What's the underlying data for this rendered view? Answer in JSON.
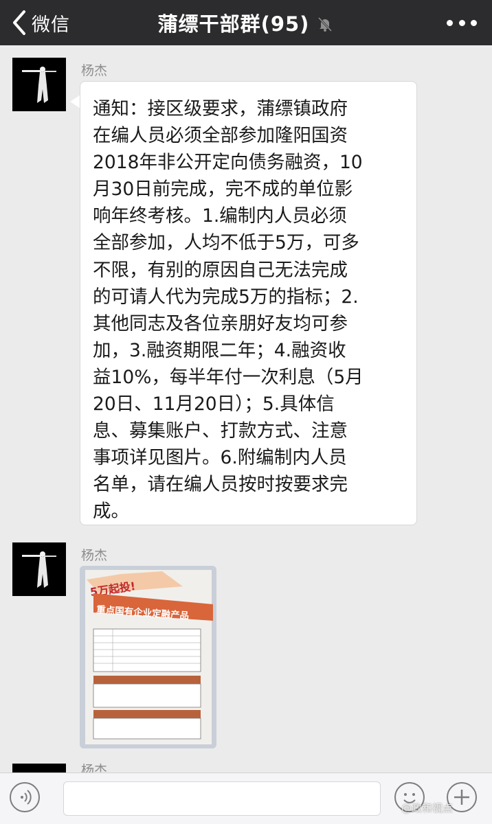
{
  "navbar": {
    "back_label": "微信",
    "title": "蒲缥干部群(95)",
    "mute_icon": "bell-slash-icon",
    "more_icon": "ellipsis-icon",
    "bg_color": "#2c2c2e"
  },
  "messages": [
    {
      "sender": "杨杰",
      "text": "通知：接区级要求，蒲缥镇政府\n在编人员必须全部参加隆阳国资\n2018年非公开定向债务融资，10\n月30日前完成，完不成的单位影\n响年终考核。1.编制内人员必须\n全部参加，人均不低于5万，可多\n不限，有别的原因自己无法完成\n的可请人代为完成5万的指标；2.\n其他同志及各位亲朋好友均可参\n加，3.融资期限二年；4.融资收\n益10%，每半年付一次利息（5月\n20日、11月20日）；5.具体信\n息、募集账户、打款方式、注意\n事项详见图片。6.附编制内人员\n名单，请在编人员按时按要求完\n成。"
    },
    {
      "sender": "杨杰",
      "photo": {
        "banner": "5万起投!",
        "headline": "重点国有企业定融产品"
      }
    },
    {
      "sender": "杨杰"
    }
  ],
  "inputbar": {
    "voice_icon": "voice-icon",
    "emoji_icon": "emoji-icon",
    "plus_icon": "plus-icon",
    "watermark": "@政和视点"
  }
}
